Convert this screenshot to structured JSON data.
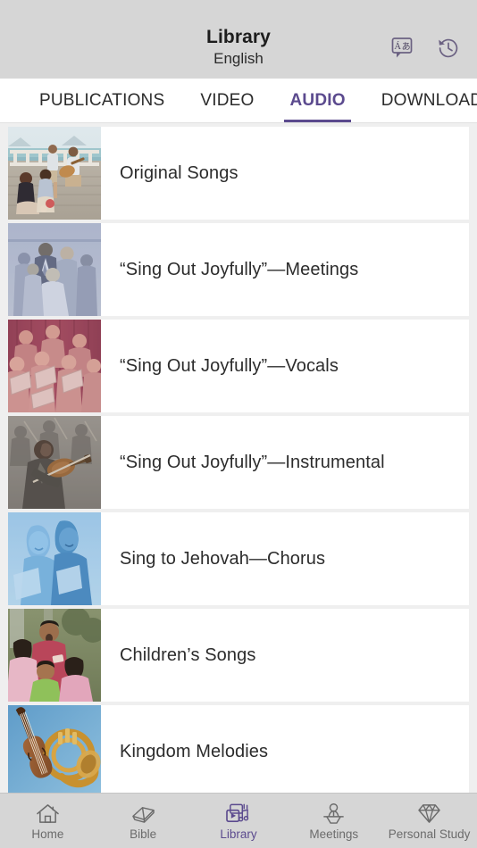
{
  "header": {
    "title": "Library",
    "subtitle": "English",
    "actions": [
      {
        "name": "language-icon",
        "label": "Á",
        "label2": "あ"
      },
      {
        "name": "history-icon",
        "label": "History"
      }
    ]
  },
  "tabs": [
    {
      "label": "PUBLICATIONS",
      "active": false
    },
    {
      "label": "VIDEO",
      "active": false
    },
    {
      "label": "AUDIO",
      "active": true
    },
    {
      "label": "DOWNLOADED",
      "active": false
    }
  ],
  "list": [
    {
      "title": "Original Songs",
      "thumb": "beach-musicians"
    },
    {
      "title": "“Sing Out Joyfully”—Meetings",
      "thumb": "blue-group-singers"
    },
    {
      "title": "“Sing Out Joyfully”—Vocals",
      "thumb": "red-choir"
    },
    {
      "title": "“Sing Out Joyfully”—Instrumental",
      "thumb": "sepia-violinist"
    },
    {
      "title": "Sing to Jehovah—Chorus",
      "thumb": "lightblue-singers"
    },
    {
      "title": "Children’s Songs",
      "thumb": "children-singing"
    },
    {
      "title": "Kingdom Melodies",
      "thumb": "violin-horn"
    }
  ],
  "bottom_nav": [
    {
      "label": "Home",
      "icon": "home-icon",
      "active": false
    },
    {
      "label": "Bible",
      "icon": "book-icon",
      "active": false
    },
    {
      "label": "Library",
      "icon": "library-media-icon",
      "active": true
    },
    {
      "label": "Meetings",
      "icon": "podium-person-icon",
      "active": false
    },
    {
      "label": "Personal Study",
      "icon": "gem-icon",
      "active": false
    }
  ],
  "colors": {
    "accent": "#5b4a8e",
    "header_bg": "#d6d6d6",
    "page_bg": "#efefef",
    "row_bg": "#ffffff",
    "text": "#2c2c2c",
    "nav_inactive": "#6b6b6b"
  }
}
